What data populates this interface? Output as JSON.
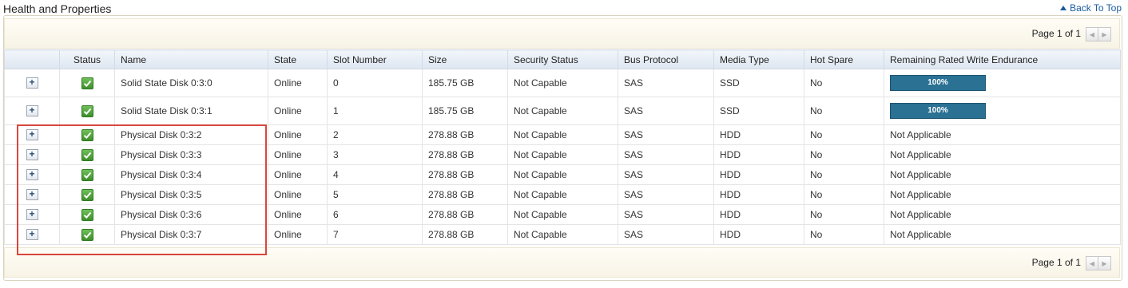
{
  "section": {
    "title": "Health and Properties",
    "back_to_top": "Back To Top"
  },
  "pager": {
    "label": "Page 1 of 1",
    "prev_icon": "chevron-left-icon",
    "next_icon": "chevron-right-icon"
  },
  "table": {
    "columns": [
      "",
      "Status",
      "Name",
      "State",
      "Slot Number",
      "Size",
      "Security Status",
      "Bus Protocol",
      "Media Type",
      "Hot Spare",
      "Remaining Rated Write Endurance"
    ],
    "rows": [
      {
        "expand": "+",
        "status": "ok",
        "name": "Solid State Disk 0:3:0",
        "state": "Online",
        "slot": "0",
        "size": "185.75 GB",
        "security": "Not Capable",
        "bus": "SAS",
        "media": "SSD",
        "hot_spare": "No",
        "endurance": "100%",
        "endurance_value": 1.0
      },
      {
        "expand": "+",
        "status": "ok",
        "name": "Solid State Disk 0:3:1",
        "state": "Online",
        "slot": "1",
        "size": "185.75 GB",
        "security": "Not Capable",
        "bus": "SAS",
        "media": "SSD",
        "hot_spare": "No",
        "endurance": "100%",
        "endurance_value": 1.0
      },
      {
        "expand": "+",
        "status": "ok",
        "name": "Physical Disk 0:3:2",
        "state": "Online",
        "slot": "2",
        "size": "278.88 GB",
        "security": "Not Capable",
        "bus": "SAS",
        "media": "HDD",
        "hot_spare": "No",
        "endurance": "Not Applicable"
      },
      {
        "expand": "+",
        "status": "ok",
        "name": "Physical Disk 0:3:3",
        "state": "Online",
        "slot": "3",
        "size": "278.88 GB",
        "security": "Not Capable",
        "bus": "SAS",
        "media": "HDD",
        "hot_spare": "No",
        "endurance": "Not Applicable"
      },
      {
        "expand": "+",
        "status": "ok",
        "name": "Physical Disk 0:3:4",
        "state": "Online",
        "slot": "4",
        "size": "278.88 GB",
        "security": "Not Capable",
        "bus": "SAS",
        "media": "HDD",
        "hot_spare": "No",
        "endurance": "Not Applicable"
      },
      {
        "expand": "+",
        "status": "ok",
        "name": "Physical Disk 0:3:5",
        "state": "Online",
        "slot": "5",
        "size": "278.88 GB",
        "security": "Not Capable",
        "bus": "SAS",
        "media": "HDD",
        "hot_spare": "No",
        "endurance": "Not Applicable"
      },
      {
        "expand": "+",
        "status": "ok",
        "name": "Physical Disk 0:3:6",
        "state": "Online",
        "slot": "6",
        "size": "278.88 GB",
        "security": "Not Capable",
        "bus": "SAS",
        "media": "HDD",
        "hot_spare": "No",
        "endurance": "Not Applicable"
      },
      {
        "expand": "+",
        "status": "ok",
        "name": "Physical Disk 0:3:7",
        "state": "Online",
        "slot": "7",
        "size": "278.88 GB",
        "security": "Not Capable",
        "bus": "SAS",
        "media": "HDD",
        "hot_spare": "No",
        "endurance": "Not Applicable"
      }
    ]
  },
  "colors": {
    "status_ok": "#3e8f2a",
    "endurance_bar": "#276b8c",
    "highlight": "#d9463e",
    "link": "#1a5c9e"
  },
  "icons": {
    "status_ok": "check-icon",
    "back_to_top": "up-arrow-icon"
  }
}
